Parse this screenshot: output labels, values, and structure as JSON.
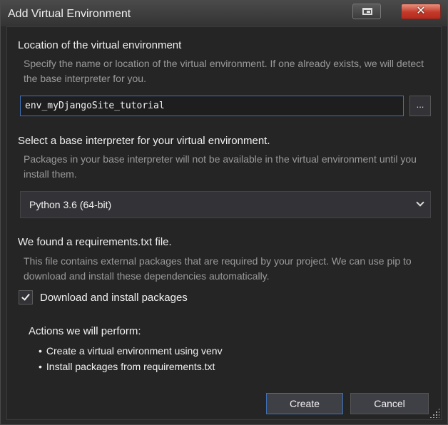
{
  "window": {
    "title": "Add Virtual Environment",
    "close_glyph": "✕"
  },
  "location": {
    "header": "Location of the virtual environment",
    "description": "Specify the name or location of the virtual environment. If one already exists, we will detect the base interpreter for you.",
    "value": "env_myDjangoSite_tutorial",
    "browse_label": "..."
  },
  "interpreter": {
    "header": "Select a base interpreter for your virtual environment.",
    "description": "Packages in your base interpreter will not be available in the virtual environment until you install them.",
    "selected": "Python 3.6 (64-bit)"
  },
  "requirements": {
    "header": "We found a requirements.txt file.",
    "description": "This file contains external packages that are required by your project. We can use pip to download and install these dependencies automatically.",
    "checkbox_label": "Download and install packages",
    "checked": true
  },
  "actions": {
    "header": "Actions we will perform:",
    "items": [
      "Create a virtual environment using venv",
      "Install packages from requirements.txt"
    ]
  },
  "buttons": {
    "create": "Create",
    "cancel": "Cancel"
  },
  "colors": {
    "accent": "#3e72b8",
    "close": "#c43a2a",
    "background": "#252526"
  },
  "icons": {
    "restore": "restore-icon",
    "close": "close-icon",
    "dropdown": "chevron-down-icon",
    "check": "checkmark-icon",
    "resize": "resize-grip-icon"
  }
}
